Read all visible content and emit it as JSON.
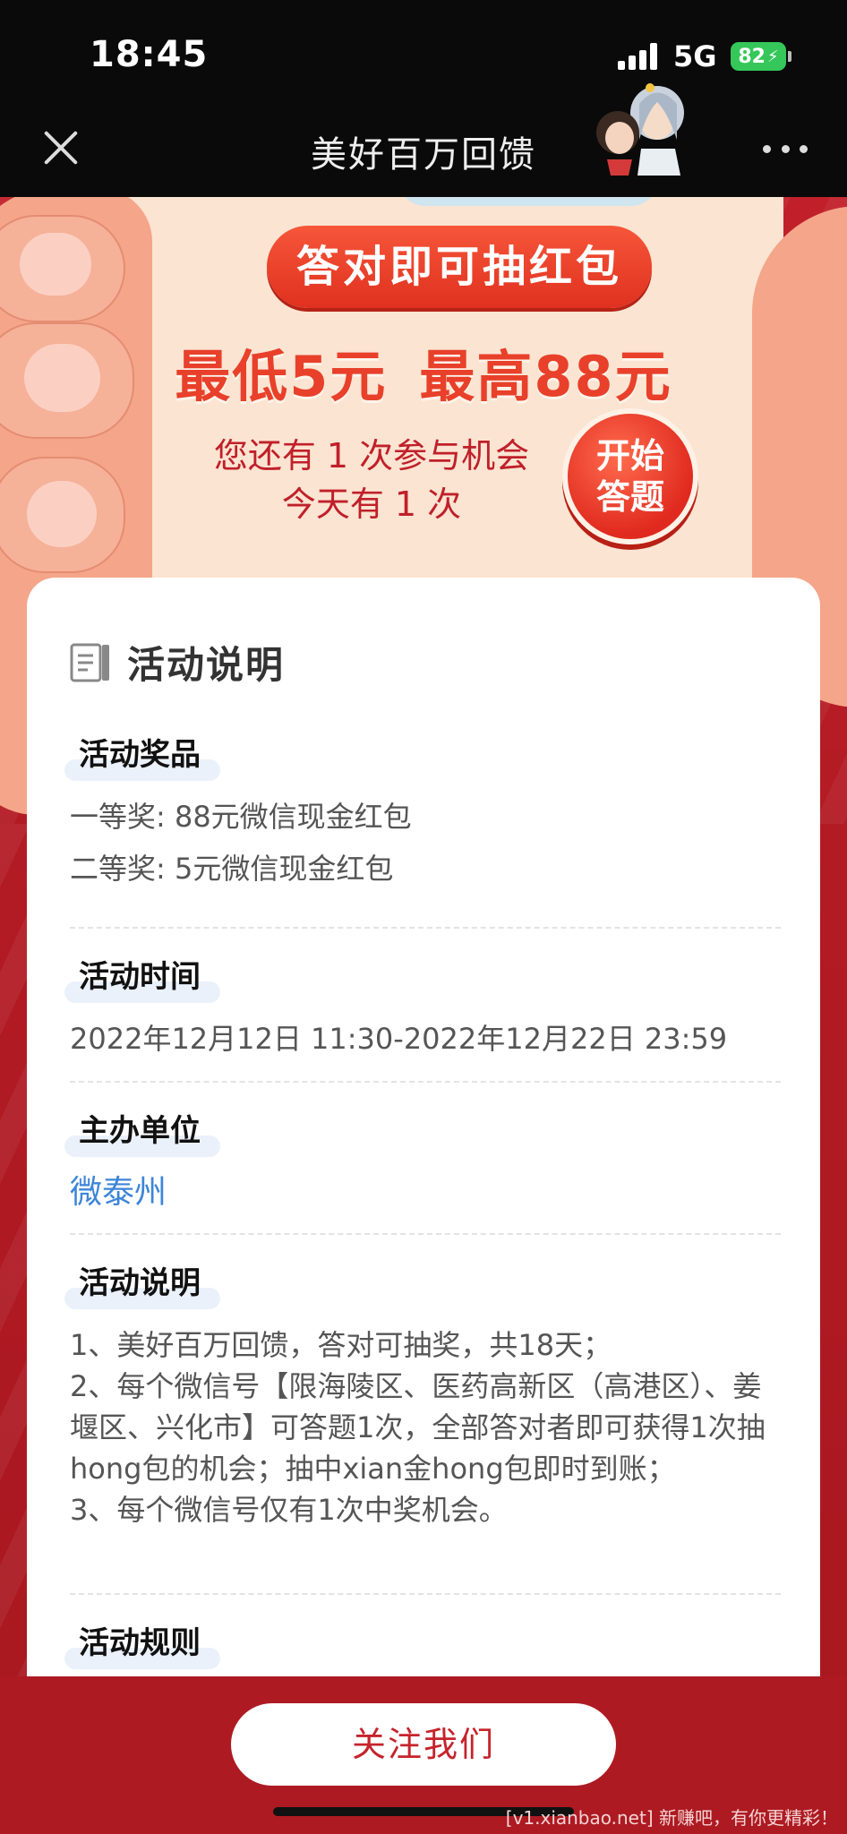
{
  "status": {
    "time": "18:45",
    "network": "5G",
    "battery": "82"
  },
  "nav": {
    "title": "美好百万回馈"
  },
  "hero": {
    "pill": "答对即可抽红包",
    "min_prize": "最低5元",
    "max_prize": "最高88元",
    "chance_line1": "您还有 1 次参与机会",
    "chance_line2": "今天有 1 次",
    "start_line1": "开始",
    "start_line2": "答题"
  },
  "content": {
    "title": "活动说明",
    "sections": [
      {
        "heading": "活动奖品",
        "lines": [
          "一等奖: 88元微信现金红包",
          "二等奖: 5元微信现金红包"
        ]
      },
      {
        "heading": "活动时间",
        "lines": [
          "2022年12月12日 11:30-2022年12月22日 23:59"
        ]
      },
      {
        "heading": "主办单位",
        "link": "微泰州"
      },
      {
        "heading": "活动说明",
        "paragraphs": [
          "1、美好百万回馈，答对可抽奖，共18天；",
          "2、每个微信号【限海陵区、医药高新区（高港区）、姜堰区、兴化市】可答题1次，全部答对者即可获得1次抽hong包的机会；抽中xian金hong包即时到账；",
          "3、每个微信号仅有1次中奖机会。"
        ]
      },
      {
        "heading": "活动规则"
      }
    ]
  },
  "bottom": {
    "follow_label": "关注我们"
  },
  "watermark": "[v1.xianbao.net] 新赚吧，有你更精彩！"
}
